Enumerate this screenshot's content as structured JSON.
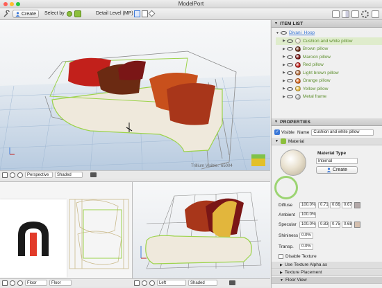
{
  "window": {
    "title": "ModelPort"
  },
  "toolbar": {
    "create_label": "Create",
    "select_by_label": "Select by",
    "detail_level_label": "Detail Level (MP)"
  },
  "main_view": {
    "overlay_label": "Trillium Visible:",
    "overlay_value": "65004",
    "camera_mode": "Perspective",
    "shading_mode": "Shaded"
  },
  "bottom_left_view": {
    "camera_mode": "Floor",
    "shading_mode": "Floor"
  },
  "bottom_right_view": {
    "camera_mode": "Left",
    "shading_mode": "Shaded"
  },
  "item_list": {
    "header": "ITEM LIST",
    "root": "Divani_Hoop",
    "items": [
      {
        "label": "Cushion and white pillow",
        "color": "#e9e4d2"
      },
      {
        "label": "Brown pillow",
        "color": "#6b2a12"
      },
      {
        "label": "Maroon pillow",
        "color": "#7a1616"
      },
      {
        "label": "Red pillow",
        "color": "#c2201b"
      },
      {
        "label": "Light brown pillow",
        "color": "#b06a3a"
      },
      {
        "label": "Orange pillow",
        "color": "#d8661c"
      },
      {
        "label": "Yellow pillow",
        "color": "#e2b63c"
      },
      {
        "label": "Metal frame",
        "color": "#b5b5b5"
      }
    ]
  },
  "properties": {
    "header": "PROPERTIES",
    "visible_label": "Visible",
    "name_label": "Name",
    "name_value": "Cushion and white pillow",
    "material_section": "Material",
    "material_type_label": "Material Type",
    "material_type_value": "Internal",
    "create_button": "Create",
    "diffuse": {
      "label": "Diffuse",
      "v1": "100.0%",
      "r": "0.71",
      "g": "0.66",
      "b": "0.67",
      "color": "#b3a9a9"
    },
    "ambient": {
      "label": "Ambient",
      "v1": "100.0%"
    },
    "specular": {
      "label": "Specular",
      "v1": "100.0%",
      "r": "0.83",
      "g": "0.75",
      "b": "0.68",
      "color": "#d4bfae"
    },
    "shininess": {
      "label": "Shininess",
      "v1": "0.0%"
    },
    "transparency": {
      "label": "Transp.",
      "v1": "0.0%"
    },
    "disable_texture_label": "Disable Texture",
    "use_texture_alpha_label": "Use Texture Alpha as",
    "texture_placement_label": "Texture Placement",
    "floor_view_label": "Floor View"
  },
  "colors": {
    "selection_green": "#9cd34a",
    "accent_blue": "#3b78d8"
  }
}
